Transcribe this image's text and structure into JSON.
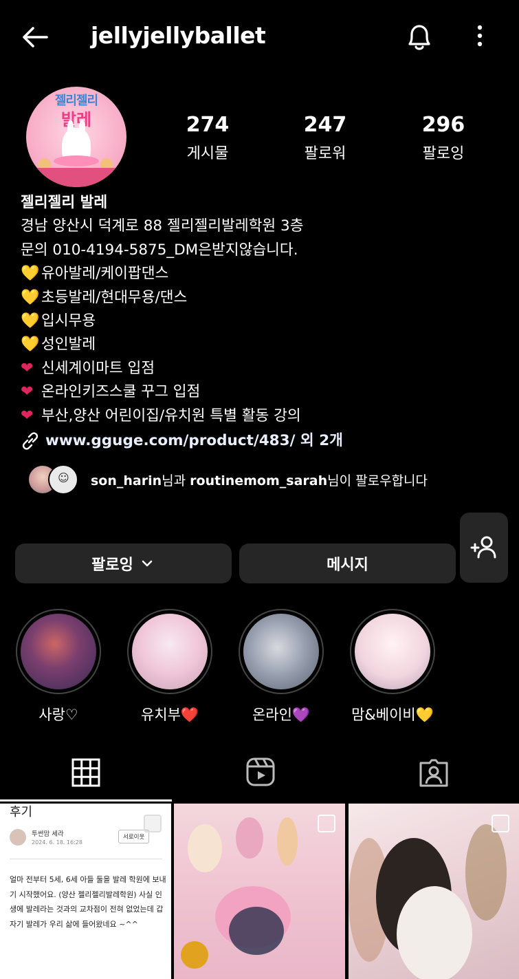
{
  "header": {
    "username": "jellyjellyballet"
  },
  "profile": {
    "avatar_text_line1": "젤리젤리",
    "avatar_text_line2": "발레",
    "stats": [
      {
        "value": "274",
        "label": "게시물"
      },
      {
        "value": "247",
        "label": "팔로워"
      },
      {
        "value": "296",
        "label": "팔로잉"
      }
    ],
    "display_name": "젤리젤리 발레",
    "bio_lines": [
      "경남 양산시 덕계로 88 젤리젤리발레학원 3층",
      "문의 010-4194-5875_DM은받지않습니다."
    ],
    "bio_items": [
      {
        "emoji": "💛",
        "text": "유아발레/케이팝댄스"
      },
      {
        "emoji": "💛",
        "text": "초등발레/현대무용/댄스"
      },
      {
        "emoji": "💛",
        "text": "입시무용"
      },
      {
        "emoji": "💛",
        "text": "성인발레"
      },
      {
        "emoji": "❤",
        "text": "신세계이마트 입점"
      },
      {
        "emoji": "❤",
        "text": "온라인키즈스쿨 꾸그 입점"
      },
      {
        "emoji": "❤",
        "text": "부산,양산 어린이집/유치원 특별 활동 강의"
      }
    ],
    "link": "www.gguge.com/product/483/ 외 2개",
    "mutual": {
      "user1": "son_harin",
      "mid": "님과 ",
      "user2": "routinemom_sarah",
      "tail": "님이 팔로우합니다"
    }
  },
  "actions": {
    "following_label": "팔로잉",
    "message_label": "메시지"
  },
  "highlights": [
    {
      "label": "사랑♡"
    },
    {
      "label": "유치부❤️"
    },
    {
      "label": "온라인💜"
    },
    {
      "label": "맘&베이비💛"
    }
  ],
  "tabs": [
    "grid-icon",
    "reels-icon",
    "tagged-icon"
  ],
  "posts": {
    "tile1": {
      "heading": "후기",
      "author": "투썬맘 세라",
      "date": "2024. 6. 18. 16:28",
      "neighbor_button": "서로이웃",
      "body": "얼마 전부터 5세, 6세 아들 둘을 발레 학원에 보내기 시작했어요. (양산 젤리젤리발레학원) 사실 인생에 발레라는 것과의 교차점이 전혀 없었는데 갑자기 발레가  우리 삶에 들어왔네요 ~^^"
    }
  },
  "colors": {
    "background": "#000000",
    "button_bg": "#262626",
    "yellow_heart": "#f5c518",
    "red_heart": "#e0245e"
  }
}
